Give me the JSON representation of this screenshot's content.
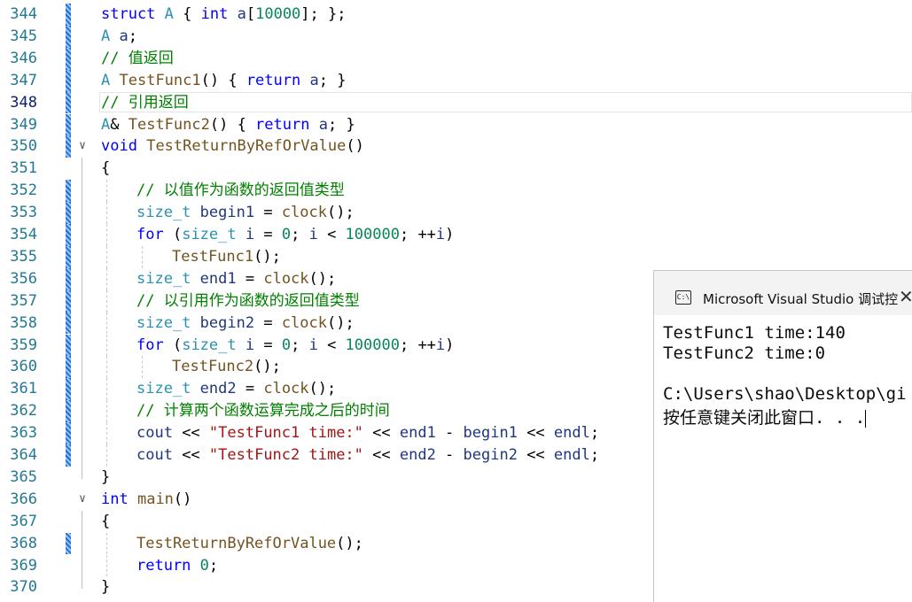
{
  "editor": {
    "lines": [
      {
        "n": "344",
        "mark": "blue",
        "tokens": [
          [
            "kw",
            "struct"
          ],
          [
            "op",
            " "
          ],
          [
            "type",
            "A"
          ],
          [
            "op",
            " { "
          ],
          [
            "kw",
            "int"
          ],
          [
            "op",
            " "
          ],
          [
            "var",
            "a"
          ],
          [
            "op",
            "["
          ],
          [
            "num",
            "10000"
          ],
          [
            "op",
            "]; };"
          ]
        ]
      },
      {
        "n": "345",
        "mark": "blue",
        "tokens": [
          [
            "type",
            "A"
          ],
          [
            "op",
            " "
          ],
          [
            "var",
            "a"
          ],
          [
            "op",
            ";"
          ]
        ]
      },
      {
        "n": "346",
        "mark": "blue",
        "tokens": [
          [
            "cm",
            "// 值返回"
          ]
        ]
      },
      {
        "n": "347",
        "mark": "blue",
        "tokens": [
          [
            "type",
            "A"
          ],
          [
            "op",
            " "
          ],
          [
            "fn",
            "TestFunc1"
          ],
          [
            "op",
            "() { "
          ],
          [
            "kw",
            "return"
          ],
          [
            "op",
            " "
          ],
          [
            "var",
            "a"
          ],
          [
            "op",
            "; }"
          ]
        ]
      },
      {
        "n": "348",
        "mark": "blue",
        "active": true,
        "tokens": [
          [
            "cm",
            "// 引用返回"
          ]
        ]
      },
      {
        "n": "349",
        "mark": "blue",
        "tokens": [
          [
            "type",
            "A"
          ],
          [
            "op",
            "& "
          ],
          [
            "fn",
            "TestFunc2"
          ],
          [
            "op",
            "() { "
          ],
          [
            "kw",
            "return"
          ],
          [
            "op",
            " "
          ],
          [
            "var",
            "a"
          ],
          [
            "op",
            "; }"
          ]
        ]
      },
      {
        "n": "350",
        "mark": "blue",
        "fold": "∨",
        "tokens": [
          [
            "kw",
            "void"
          ],
          [
            "op",
            " "
          ],
          [
            "fn",
            "TestReturnByRefOrValue"
          ],
          [
            "op",
            "()"
          ]
        ]
      },
      {
        "n": "351",
        "tokens": [
          [
            "op",
            "{"
          ]
        ]
      },
      {
        "n": "352",
        "mark": "blue",
        "indent": 1,
        "tokens": [
          [
            "cm",
            "// 以值作为函数的返回值类型"
          ]
        ]
      },
      {
        "n": "353",
        "mark": "blue",
        "indent": 1,
        "tokens": [
          [
            "type",
            "size_t"
          ],
          [
            "op",
            " "
          ],
          [
            "var",
            "begin1"
          ],
          [
            "op",
            " = "
          ],
          [
            "fn",
            "clock"
          ],
          [
            "op",
            "();"
          ]
        ]
      },
      {
        "n": "354",
        "mark": "blue",
        "indent": 1,
        "tokens": [
          [
            "kw",
            "for"
          ],
          [
            "op",
            " ("
          ],
          [
            "type",
            "size_t"
          ],
          [
            "op",
            " "
          ],
          [
            "var",
            "i"
          ],
          [
            "op",
            " = "
          ],
          [
            "num",
            "0"
          ],
          [
            "op",
            "; "
          ],
          [
            "var",
            "i"
          ],
          [
            "op",
            " < "
          ],
          [
            "num",
            "100000"
          ],
          [
            "op",
            "; ++"
          ],
          [
            "var",
            "i"
          ],
          [
            "op",
            ")"
          ]
        ]
      },
      {
        "n": "355",
        "mark": "blue",
        "indent": 2,
        "tokens": [
          [
            "fn",
            "TestFunc1"
          ],
          [
            "op",
            "();"
          ]
        ]
      },
      {
        "n": "356",
        "mark": "blue",
        "indent": 1,
        "tokens": [
          [
            "type",
            "size_t"
          ],
          [
            "op",
            " "
          ],
          [
            "var",
            "end1"
          ],
          [
            "op",
            " = "
          ],
          [
            "fn",
            "clock"
          ],
          [
            "op",
            "();"
          ]
        ]
      },
      {
        "n": "357",
        "mark": "blue",
        "indent": 1,
        "tokens": [
          [
            "cm",
            "// 以引用作为函数的返回值类型"
          ]
        ]
      },
      {
        "n": "358",
        "mark": "blue",
        "indent": 1,
        "tokens": [
          [
            "type",
            "size_t"
          ],
          [
            "op",
            " "
          ],
          [
            "var",
            "begin2"
          ],
          [
            "op",
            " = "
          ],
          [
            "fn",
            "clock"
          ],
          [
            "op",
            "();"
          ]
        ]
      },
      {
        "n": "359",
        "mark": "blue",
        "indent": 1,
        "tokens": [
          [
            "kw",
            "for"
          ],
          [
            "op",
            " ("
          ],
          [
            "type",
            "size_t"
          ],
          [
            "op",
            " "
          ],
          [
            "var",
            "i"
          ],
          [
            "op",
            " = "
          ],
          [
            "num",
            "0"
          ],
          [
            "op",
            "; "
          ],
          [
            "var",
            "i"
          ],
          [
            "op",
            " < "
          ],
          [
            "num",
            "100000"
          ],
          [
            "op",
            "; ++"
          ],
          [
            "var",
            "i"
          ],
          [
            "op",
            ")"
          ]
        ]
      },
      {
        "n": "360",
        "mark": "blue",
        "indent": 2,
        "tokens": [
          [
            "fn",
            "TestFunc2"
          ],
          [
            "op",
            "();"
          ]
        ]
      },
      {
        "n": "361",
        "mark": "blue",
        "indent": 1,
        "tokens": [
          [
            "type",
            "size_t"
          ],
          [
            "op",
            " "
          ],
          [
            "var",
            "end2"
          ],
          [
            "op",
            " = "
          ],
          [
            "fn",
            "clock"
          ],
          [
            "op",
            "();"
          ]
        ]
      },
      {
        "n": "362",
        "mark": "blue",
        "indent": 1,
        "tokens": [
          [
            "cm",
            "// 计算两个函数运算完成之后的时间"
          ]
        ]
      },
      {
        "n": "363",
        "mark": "blue",
        "indent": 1,
        "tokens": [
          [
            "var",
            "cout"
          ],
          [
            "op",
            " << "
          ],
          [
            "str",
            "\"TestFunc1 time:\""
          ],
          [
            "op",
            " << "
          ],
          [
            "var",
            "end1"
          ],
          [
            "op",
            " - "
          ],
          [
            "var",
            "begin1"
          ],
          [
            "op",
            " << "
          ],
          [
            "var",
            "endl"
          ],
          [
            "op",
            ";"
          ]
        ]
      },
      {
        "n": "364",
        "mark": "blue",
        "indent": 1,
        "tokens": [
          [
            "var",
            "cout"
          ],
          [
            "op",
            " << "
          ],
          [
            "str",
            "\"TestFunc2 time:\""
          ],
          [
            "op",
            " << "
          ],
          [
            "var",
            "end2"
          ],
          [
            "op",
            " - "
          ],
          [
            "var",
            "begin2"
          ],
          [
            "op",
            " << "
          ],
          [
            "var",
            "endl"
          ],
          [
            "op",
            ";"
          ]
        ]
      },
      {
        "n": "365",
        "tokens": [
          [
            "op",
            "}"
          ]
        ]
      },
      {
        "n": "366",
        "fold": "∨",
        "tokens": [
          [
            "kw",
            "int"
          ],
          [
            "op",
            " "
          ],
          [
            "fn",
            "main"
          ],
          [
            "op",
            "()"
          ]
        ]
      },
      {
        "n": "367",
        "tokens": [
          [
            "op",
            "{"
          ]
        ]
      },
      {
        "n": "368",
        "mark": "blue",
        "indent": 1,
        "tokens": [
          [
            "fn",
            "TestReturnByRefOrValue"
          ],
          [
            "op",
            "();"
          ]
        ]
      },
      {
        "n": "369",
        "indent": 1,
        "tokens": [
          [
            "kw",
            "return"
          ],
          [
            "op",
            " "
          ],
          [
            "num",
            "0"
          ],
          [
            "op",
            ";"
          ]
        ]
      },
      {
        "n": "370",
        "tokens": [
          [
            "op",
            "}"
          ]
        ]
      }
    ]
  },
  "console": {
    "icon": "console-app-icon",
    "title": "Microsoft Visual Studio 调试控",
    "close": "✕",
    "lines": [
      "TestFunc1 time:140",
      "TestFunc2 time:0",
      "",
      "C:\\Users\\shao\\Desktop\\gi",
      "按任意键关闭此窗口. . ."
    ]
  }
}
